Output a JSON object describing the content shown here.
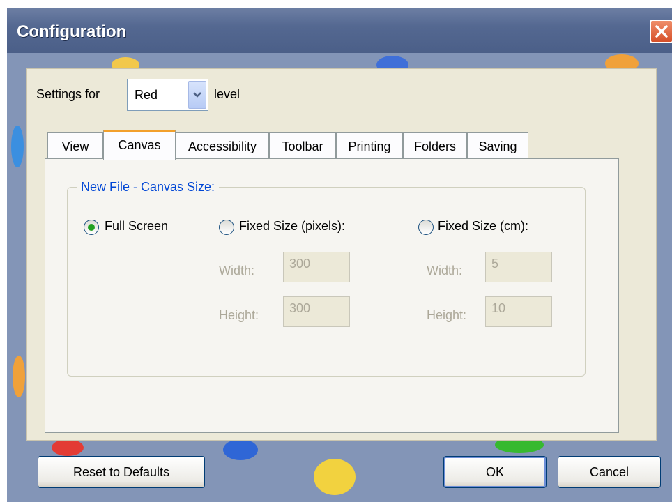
{
  "window": {
    "title": "Configuration",
    "close_icon": "close-icon"
  },
  "settings": {
    "prefix_label": "Settings for",
    "level_value": "Red",
    "suffix_label": "level"
  },
  "tabs": [
    {
      "label": "View",
      "active": false
    },
    {
      "label": "Canvas",
      "active": true
    },
    {
      "label": "Accessibility",
      "active": false
    },
    {
      "label": "Toolbar",
      "active": false
    },
    {
      "label": "Printing",
      "active": false
    },
    {
      "label": "Folders",
      "active": false
    },
    {
      "label": "Saving",
      "active": false
    }
  ],
  "canvas": {
    "group_title": "New File - Canvas Size:",
    "full_screen": {
      "label": "Full Screen",
      "selected": true
    },
    "fixed_pixels": {
      "label": "Fixed Size (pixels):",
      "selected": false,
      "width_label": "Width:",
      "width_value": "300",
      "height_label": "Height:",
      "height_value": "300"
    },
    "fixed_cm": {
      "label": "Fixed Size (cm):",
      "selected": false,
      "width_label": "Width:",
      "width_value": "5",
      "height_label": "Height:",
      "height_value": "10"
    }
  },
  "buttons": {
    "reset": "Reset to Defaults",
    "ok": "OK",
    "cancel": "Cancel"
  },
  "colors": {
    "title_bar": "#546891",
    "panel": "#ece9d8",
    "active_tab_accent": "#f2a02b",
    "group_title": "#0046d5",
    "radio_dot": "#21a121",
    "close_button": "#d6502a"
  }
}
